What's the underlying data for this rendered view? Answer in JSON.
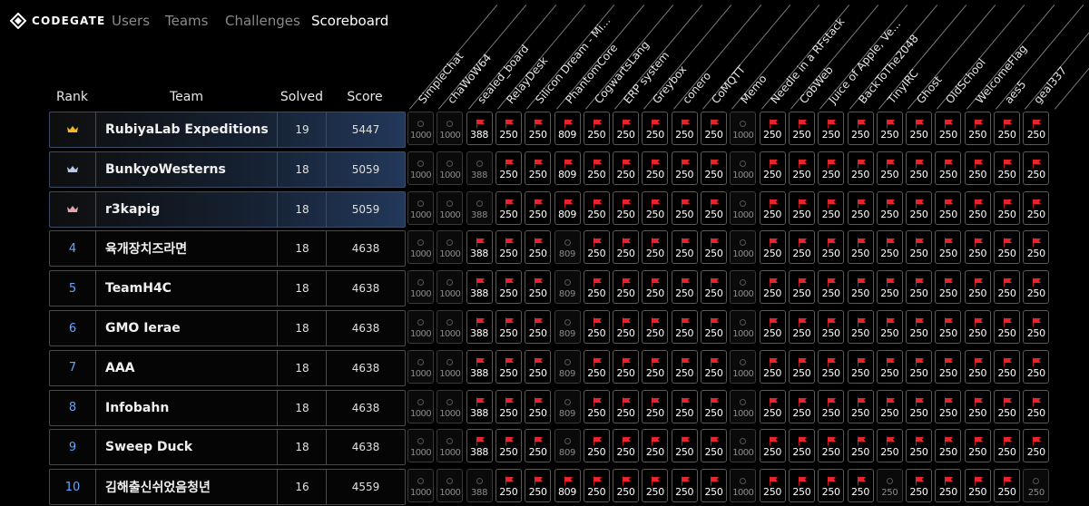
{
  "brand": {
    "name": "CODEGATE"
  },
  "nav": {
    "links": [
      "Users",
      "Teams",
      "Challenges",
      "Scoreboard"
    ],
    "active": "Scoreboard"
  },
  "table": {
    "headers": {
      "rank": "Rank",
      "team": "Team",
      "solved": "Solved",
      "score": "Score"
    },
    "challenges": [
      "SimpleChat",
      "chaWoW64",
      "sealed_board",
      "RelayDesk",
      "Silicon Dream - Mi...",
      "PhantomCore",
      "CogwartsLang",
      "ERP system",
      "Greybox",
      "conero",
      "CoMQTT",
      "Memo",
      "Needle in a RFstack",
      "CobWeb",
      "Juice of Apple, Ve...",
      "BackToThe2048",
      "TinyIRC",
      "Ghost",
      "OldSchool",
      "WelcomeFlag",
      "aes5",
      "geal337"
    ],
    "challenge_points": [
      1000,
      1000,
      388,
      250,
      250,
      809,
      250,
      250,
      250,
      250,
      250,
      1000,
      250,
      250,
      250,
      250,
      250,
      250,
      250,
      250,
      250,
      250
    ],
    "rows": [
      {
        "rank": "1",
        "rank_icon": "crown-icon",
        "rank_color": "#f5b820",
        "team": "RubiyaLab Expeditions",
        "solved": "19",
        "score": "5447",
        "solved_mask": "0011111111101111111111"
      },
      {
        "rank": "2",
        "rank_icon": "crown-icon",
        "rank_color": "#b7c9e8",
        "team": "BunkyoWesterns",
        "solved": "18",
        "score": "5059",
        "solved_mask": "0001111111101111111111"
      },
      {
        "rank": "3",
        "rank_icon": "crown-icon",
        "rank_color": "#e8a3b0",
        "team": "r3kapig",
        "solved": "18",
        "score": "5059",
        "solved_mask": "0001111111101111111111"
      },
      {
        "rank": "4",
        "rank_icon": "",
        "rank_color": "#5fa8ff",
        "team": "육개장치즈라면",
        "solved": "18",
        "score": "4638",
        "solved_mask": "0011101111101111111111"
      },
      {
        "rank": "5",
        "rank_icon": "",
        "rank_color": "#5fa8ff",
        "team": "TeamH4C",
        "solved": "18",
        "score": "4638",
        "solved_mask": "0011101111101111111111"
      },
      {
        "rank": "6",
        "rank_icon": "",
        "rank_color": "#5fa8ff",
        "team": "GMO Ierae",
        "solved": "18",
        "score": "4638",
        "solved_mask": "0011101111101111111111"
      },
      {
        "rank": "7",
        "rank_icon": "",
        "rank_color": "#5fa8ff",
        "team": "AAA",
        "solved": "18",
        "score": "4638",
        "solved_mask": "0011101111101111111111"
      },
      {
        "rank": "8",
        "rank_icon": "",
        "rank_color": "#5fa8ff",
        "team": "Infobahn",
        "solved": "18",
        "score": "4638",
        "solved_mask": "0011101111101111111111"
      },
      {
        "rank": "9",
        "rank_icon": "",
        "rank_color": "#5fa8ff",
        "team": "Sweep Duck",
        "solved": "18",
        "score": "4638",
        "solved_mask": "0011101111101111111111"
      },
      {
        "rank": "10",
        "rank_icon": "",
        "rank_color": "#5fa8ff",
        "team": "김해출신쉬었음청년",
        "solved": "16",
        "score": "4559",
        "solved_mask": "0001111111101111011110"
      }
    ]
  },
  "colors": {
    "flag": "#e8242a",
    "rank_number": "#5fa8ff",
    "top3_gradient_end": "#22385a"
  }
}
